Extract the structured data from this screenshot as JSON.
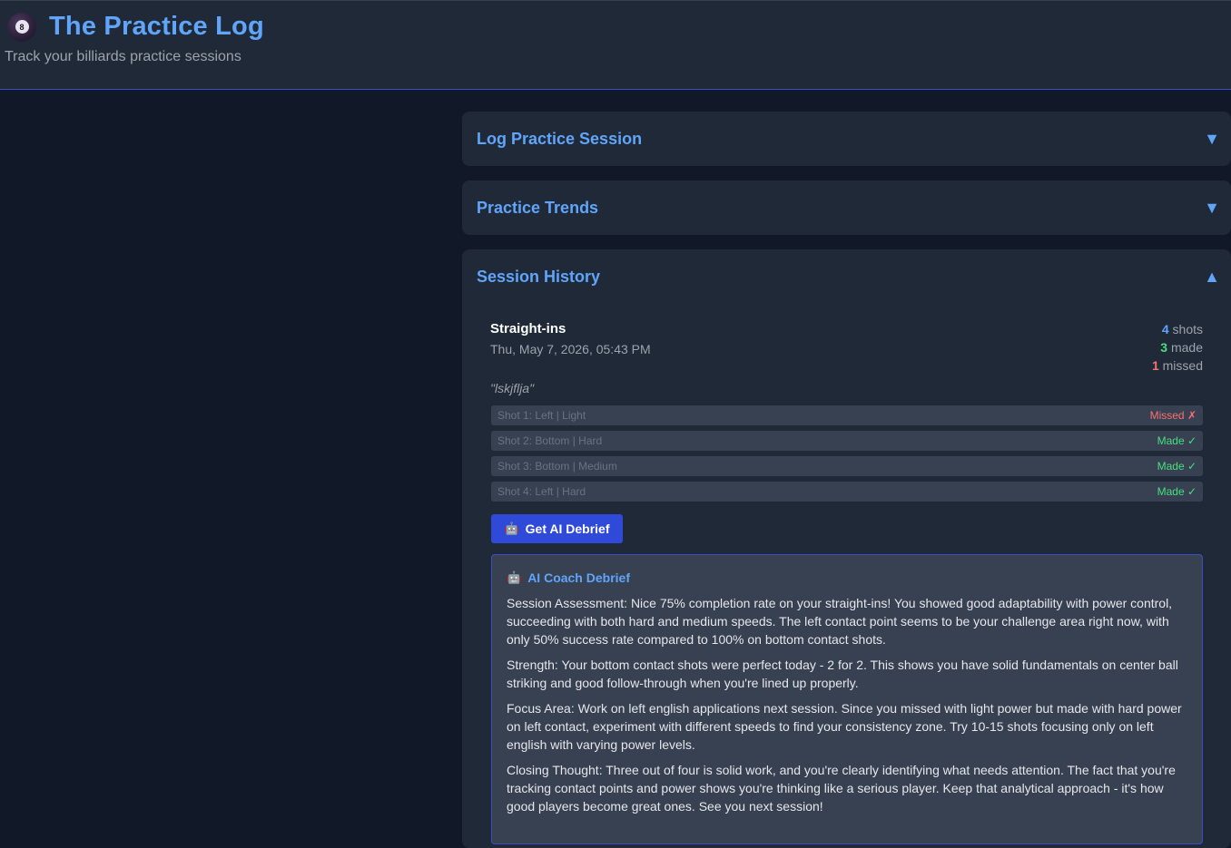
{
  "header": {
    "title": "The Practice Log",
    "subtitle": "Track your billiards practice sessions",
    "logo_icon": "8"
  },
  "panels": {
    "log": {
      "title": "Log Practice Session",
      "caret": "▼"
    },
    "trends": {
      "title": "Practice Trends",
      "caret": "▼"
    },
    "history": {
      "title": "Session History",
      "caret": "▲"
    }
  },
  "session": {
    "name": "Straight-ins",
    "date": "Thu, May 7, 2026, 05:43 PM",
    "shots_count": "4",
    "shots_label": "shots",
    "made_count": "3",
    "made_label": "made",
    "missed_count": "1",
    "missed_label": "missed",
    "note": "\"lskjflja\"",
    "shots": [
      {
        "label": "Shot 1: Left | Light",
        "result": "Missed ✗"
      },
      {
        "label": "Shot 2: Bottom | Hard",
        "result": "Made ✓"
      },
      {
        "label": "Shot 3: Bottom | Medium",
        "result": "Made ✓"
      },
      {
        "label": "Shot 4: Left | Hard",
        "result": "Made ✓"
      }
    ]
  },
  "debrief_button": {
    "label": "Get AI Debrief",
    "icon": "robot-icon"
  },
  "coach": {
    "title": "AI Coach Debrief",
    "paragraphs": [
      "Session Assessment: Nice 75% completion rate on your straight-ins! You showed good adaptability with power control, succeeding with both hard and medium speeds. The left contact point seems to be your challenge area right now, with only 50% success rate compared to 100% on bottom contact shots.",
      "Strength: Your bottom contact shots were perfect today - 2 for 2. This shows you have solid fundamentals on center ball striking and good follow-through when you're lined up properly.",
      "Focus Area: Work on left english applications next session. Since you missed with light power but made with hard power on left contact, experiment with different speeds to find your consistency zone. Try 10-15 shots focusing only on left english with varying power levels.",
      "Closing Thought: Three out of four is solid work, and you're clearly identifying what needs attention. The fact that you're tracking contact points and power shows you're thinking like a serious player. Keep that analytical approach - it's how good players become great ones. See you next session!"
    ]
  },
  "colors": {
    "background": "#111827",
    "panel": "#1f2937",
    "accent": "#60a5fa",
    "button": "#2f4ad8",
    "made": "#4ade80",
    "missed": "#f87171"
  }
}
